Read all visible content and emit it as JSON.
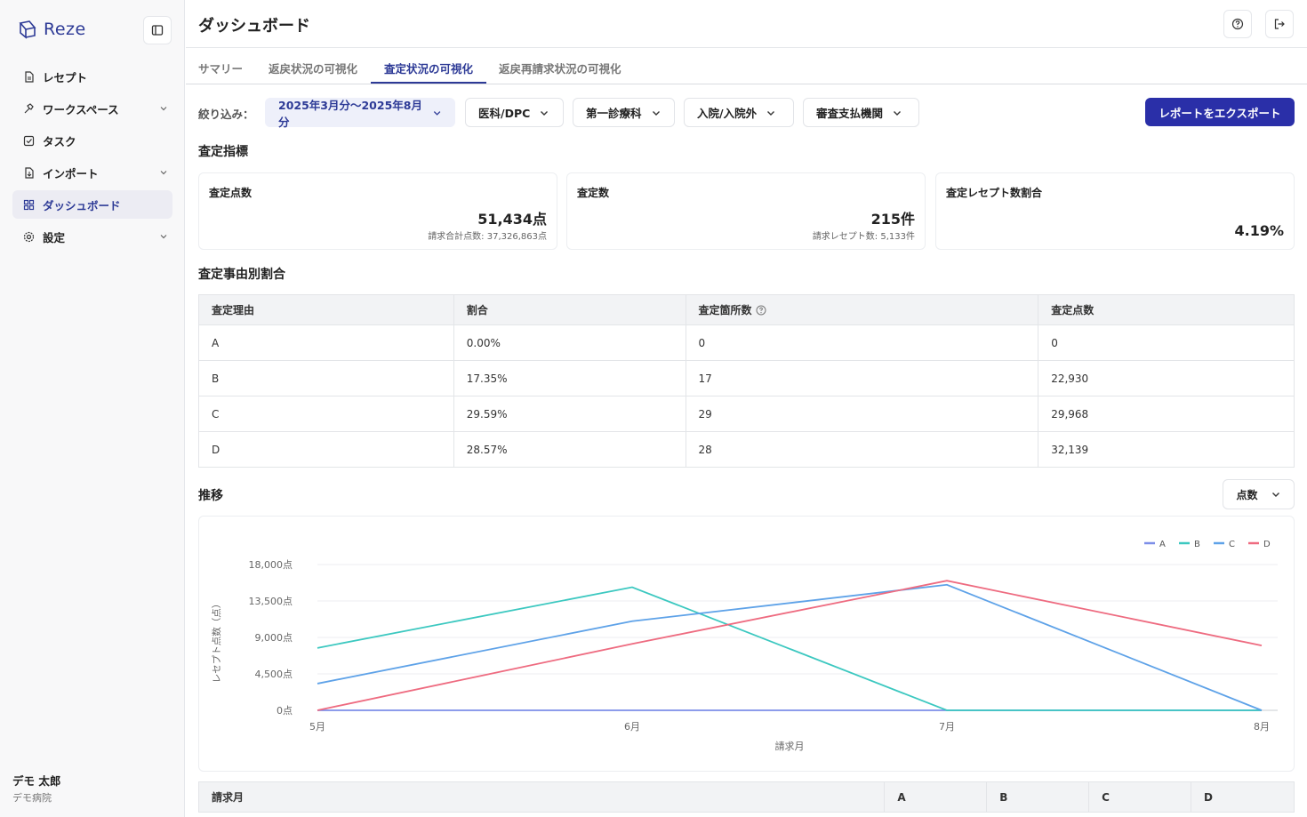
{
  "app": {
    "brand": "Reze"
  },
  "sidebar": {
    "items": [
      {
        "label": "レセプト",
        "icon": "document-icon",
        "active": false,
        "has_chevron": false
      },
      {
        "label": "ワークスペース",
        "icon": "tools-icon",
        "active": false,
        "has_chevron": true
      },
      {
        "label": "タスク",
        "icon": "checkbox-icon",
        "active": false,
        "has_chevron": false
      },
      {
        "label": "インポート",
        "icon": "import-file-icon",
        "active": false,
        "has_chevron": true
      },
      {
        "label": "ダッシュボード",
        "icon": "grid-icon",
        "active": true,
        "has_chevron": false
      },
      {
        "label": "設定",
        "icon": "gear-icon",
        "active": false,
        "has_chevron": true
      }
    ],
    "user": {
      "name": "デモ 太郎",
      "org": "デモ病院"
    }
  },
  "header": {
    "title": "ダッシュボード"
  },
  "tabs": [
    {
      "label": "サマリー",
      "active": false
    },
    {
      "label": "返戻状況の可視化",
      "active": false
    },
    {
      "label": "査定状況の可視化",
      "active": true
    },
    {
      "label": "返戻再請求状況の可視化",
      "active": false
    }
  ],
  "filters": {
    "label": "絞り込み：",
    "date_range": "2025年3月分〜2025年8月分",
    "department": "医科/DPC",
    "first_department": "第一診療科",
    "inpatient": "入院/入院外",
    "payer": "審査支払機関",
    "export_label": "レポートをエクスポート"
  },
  "kpi_section": {
    "title": "査定指標",
    "cards": [
      {
        "label": "査定点数",
        "value": "51,434点",
        "sub": "請求合計点数: 37,326,863点"
      },
      {
        "label": "査定数",
        "value": "215件",
        "sub": "請求レセプト数: 5,133件"
      },
      {
        "label": "査定レセプト数割合",
        "value": "4.19%",
        "sub": ""
      }
    ]
  },
  "reason_section": {
    "title": "査定事由別割合",
    "headers": [
      "査定理由",
      "割合",
      "査定箇所数",
      "査定点数"
    ],
    "rows": [
      [
        "A",
        "0.00%",
        "0",
        "0"
      ],
      [
        "B",
        "17.35%",
        "17",
        "22,930"
      ],
      [
        "C",
        "29.59%",
        "29",
        "29,968"
      ],
      [
        "D",
        "28.57%",
        "28",
        "32,139"
      ]
    ]
  },
  "trend_section": {
    "title": "推移",
    "metric": "点数"
  },
  "chart_data": {
    "type": "line",
    "categories": [
      "5月",
      "6月",
      "7月",
      "8月"
    ],
    "series": [
      {
        "name": "A",
        "color": "#7d8ee8",
        "values": [
          0,
          0,
          0,
          0
        ]
      },
      {
        "name": "B",
        "color": "#3cc8c0",
        "values": [
          7700,
          15200,
          0,
          0
        ]
      },
      {
        "name": "C",
        "color": "#5ea2e8",
        "values": [
          3300,
          11000,
          15500,
          0
        ]
      },
      {
        "name": "D",
        "color": "#ee6b80",
        "values": [
          0,
          8200,
          16000,
          8000
        ]
      }
    ],
    "yticks": [
      "0点",
      "4,500点",
      "9,000点",
      "13,500点",
      "18,000点"
    ],
    "ylim": [
      0,
      18000
    ],
    "xlabel": "請求月",
    "ylabel": "レセプト点数（点）",
    "legend": "top-right",
    "grid": true
  },
  "month_table": {
    "headers": [
      "請求月",
      "A",
      "B",
      "C",
      "D"
    ]
  }
}
